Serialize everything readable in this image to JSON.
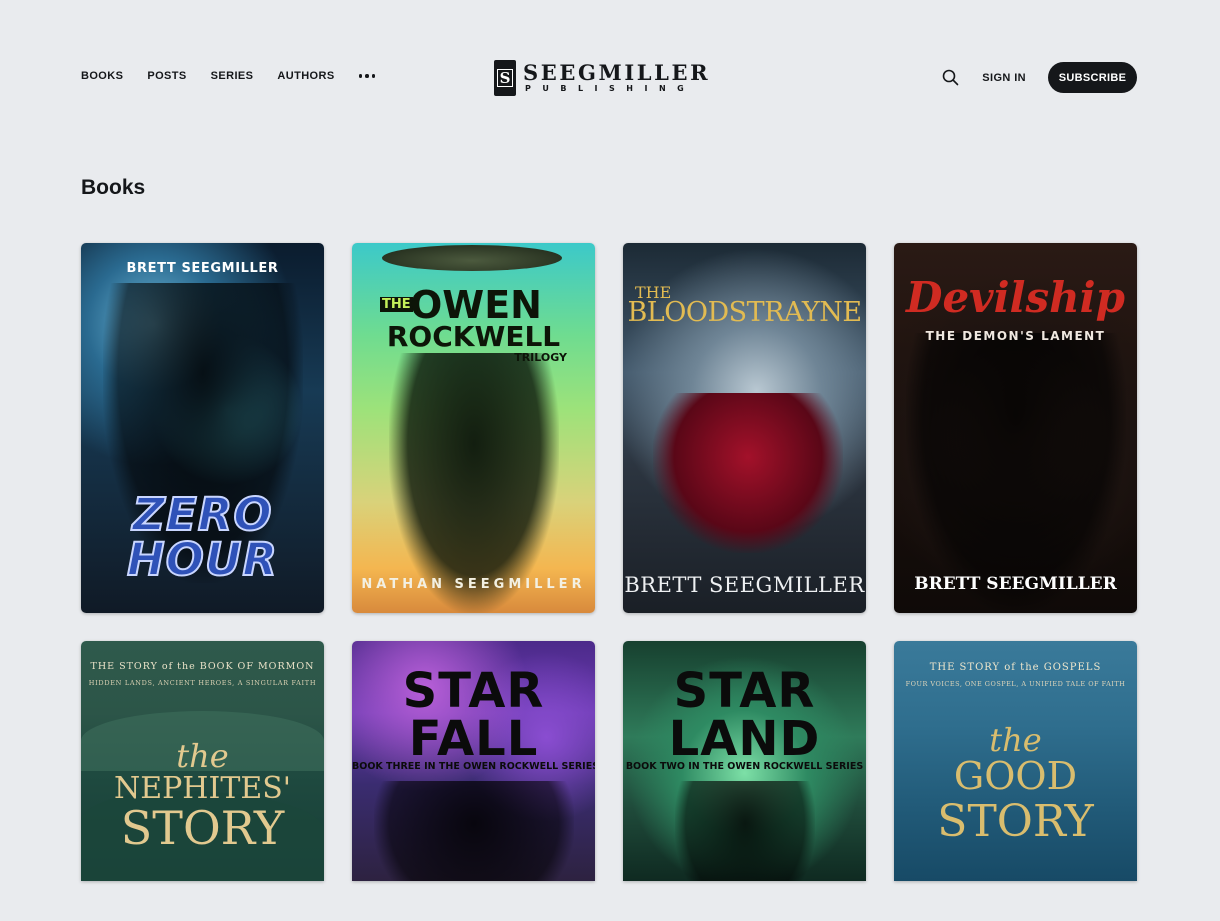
{
  "nav": {
    "items": [
      "BOOKS",
      "POSTS",
      "SERIES",
      "AUTHORS"
    ],
    "more_icon": "ellipsis-icon"
  },
  "logo": {
    "mark": "S",
    "name": "SEEGMILLER",
    "sub": "PUBLISHING"
  },
  "header": {
    "search_icon": "search-icon",
    "signin": "SIGN IN",
    "subscribe": "SUBSCRIBE"
  },
  "section": {
    "title": "Books"
  },
  "books": [
    {
      "author": "BRETT SEEGMILLER",
      "title_line1": "ZERO",
      "title_line2": "HOUR"
    },
    {
      "title_prefix": "THE",
      "title_line1": "OWEN",
      "title_line2": "ROCKWELL",
      "subtitle": "TRILOGY",
      "author": "NATHAN SEEGMILLER"
    },
    {
      "title_prefix": "THE",
      "title_line1": "BLOODSTRAYNE",
      "author": "BRETT SEEGMILLER"
    },
    {
      "title_line1": "Devilship",
      "subtitle": "THE DEMON'S LAMENT",
      "author": "BRETT SEEGMILLER"
    },
    {
      "series_line": "THE STORY of the BOOK OF MORMON",
      "tagline": "HIDDEN LANDS, ANCIENT HEROES, A SINGULAR FAITH",
      "title_prefix": "the",
      "title_line1": "NEPHITES'",
      "title_line2": "STORY"
    },
    {
      "title_line1": "STAR",
      "title_line2": "FALL",
      "series_line": "BOOK THREE IN THE OWEN ROCKWELL SERIES"
    },
    {
      "title_line1": "STAR",
      "title_line2": "LAND",
      "series_line": "BOOK TWO IN THE OWEN ROCKWELL SERIES"
    },
    {
      "series_line": "THE STORY of the GOSPELS",
      "tagline": "FOUR VOICES, ONE GOSPEL, A UNIFIED TALE OF FAITH",
      "title_prefix": "the",
      "title_line1": "GOOD",
      "title_line2": "STORY"
    }
  ],
  "colors": {
    "background": "#e9ebee",
    "text": "#15171a",
    "button": "#15171a"
  }
}
